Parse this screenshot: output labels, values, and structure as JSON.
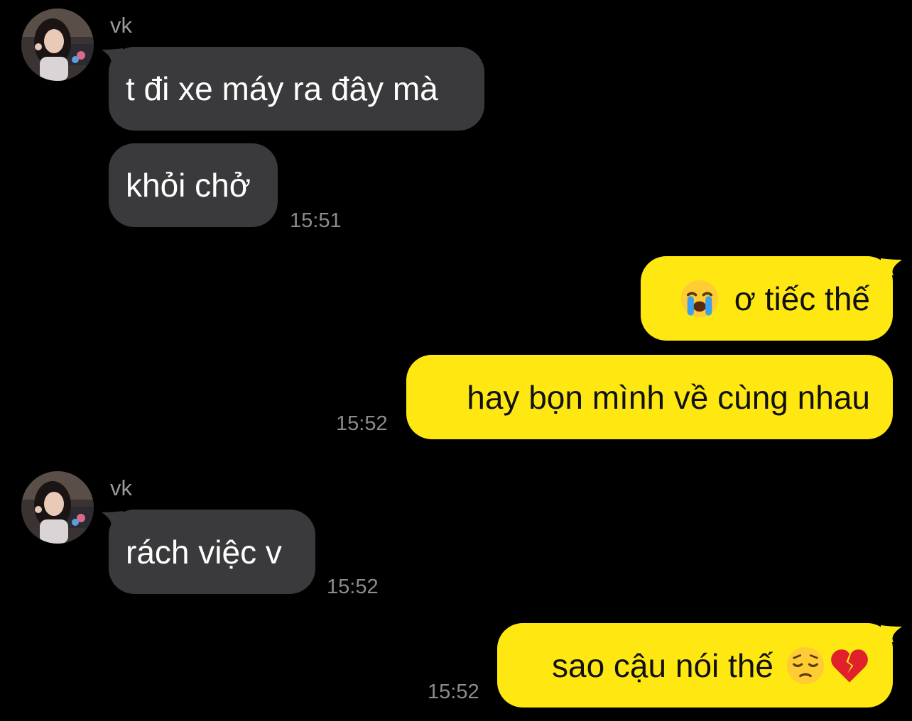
{
  "chat": {
    "colors": {
      "background": "#000000",
      "incoming_bubble": "#3a3a3c",
      "outgoing_bubble": "#ffe812",
      "timestamp": "#8c8c8c"
    },
    "groups": [
      {
        "direction": "incoming",
        "sender": "vk",
        "avatar": "profile-photo",
        "messages": [
          "t đi xe máy ra đây mà",
          "khỏi chở"
        ],
        "time": "15:51"
      },
      {
        "direction": "outgoing",
        "messages": [
          {
            "emoji_before": "loudly-crying-face",
            "text": "ơ tiếc thế"
          },
          {
            "text": "hay bọn mình về cùng nhau"
          }
        ],
        "time": "15:52"
      },
      {
        "direction": "incoming",
        "sender": "vk",
        "avatar": "profile-photo",
        "messages": [
          "rách việc v"
        ],
        "time": "15:52"
      },
      {
        "direction": "outgoing",
        "messages": [
          {
            "text": "sao cậu nói thế",
            "emoji_after": [
              "pensive-face",
              "broken-heart"
            ]
          }
        ],
        "time": "15:52"
      }
    ]
  }
}
